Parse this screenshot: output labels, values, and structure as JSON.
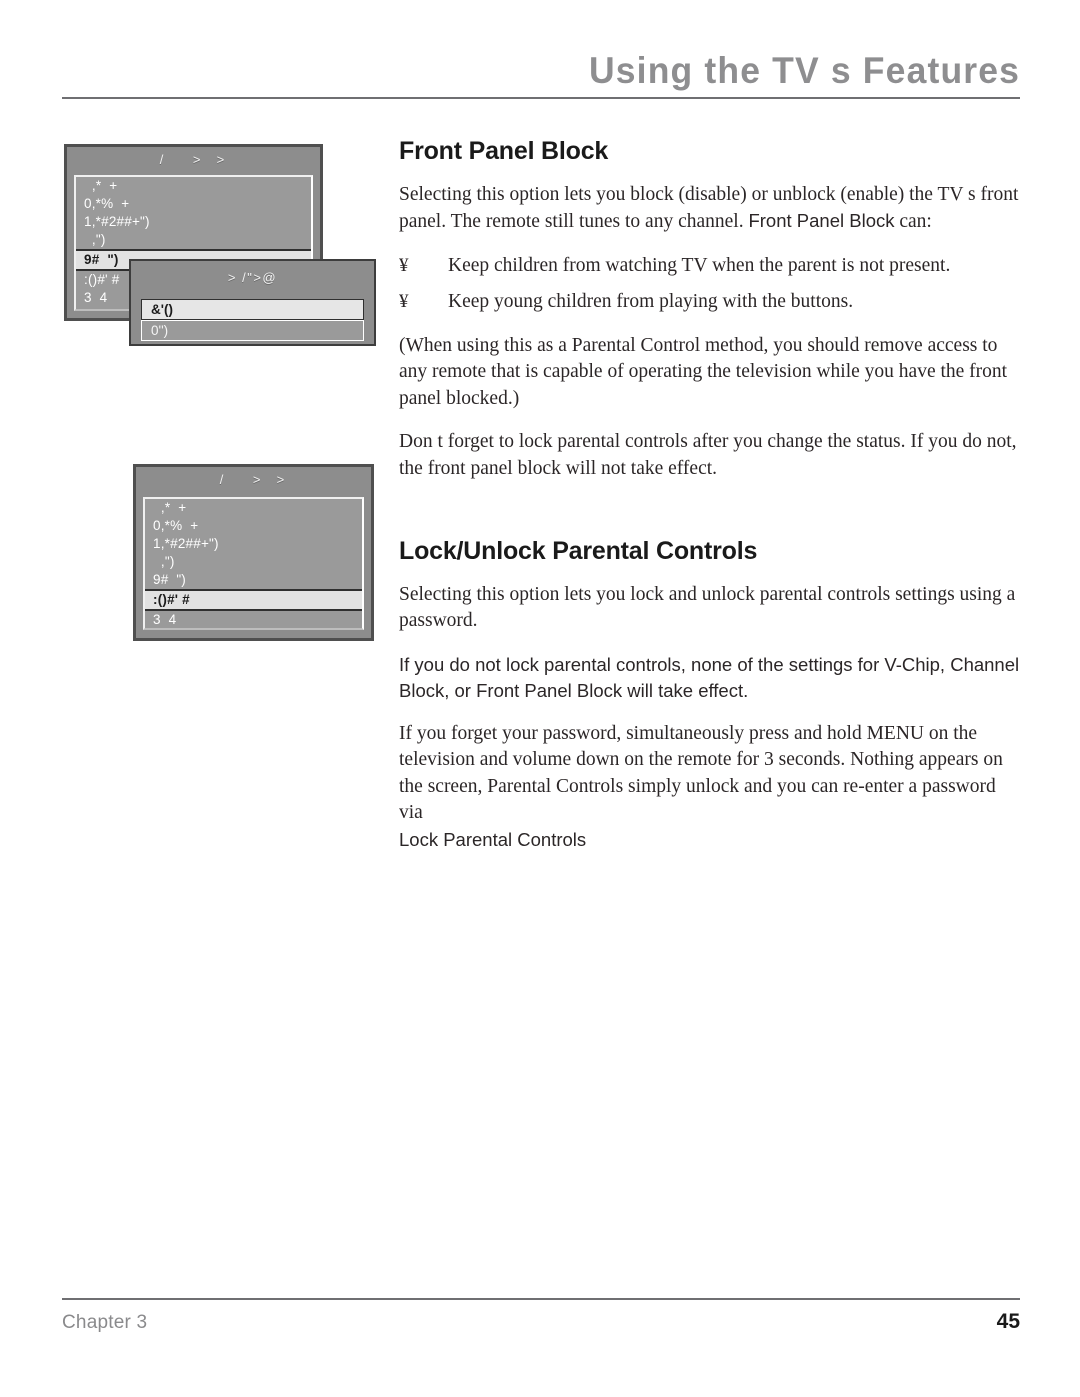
{
  "header": {
    "title": "Using the TV s Features"
  },
  "sections": {
    "front_panel_block": {
      "heading": "Front Panel Block",
      "intro_part1": "Selecting this option lets you block (disable) or unblock (enable) the TV s front panel. The remote still tunes to any channel. ",
      "intro_emphasis": "Front Panel Block",
      "intro_part2": " can:",
      "bullets": [
        {
          "mark": "¥",
          "text": "Keep children from watching TV when the parent is not present."
        },
        {
          "mark": "¥",
          "text": "Keep young children from playing with the buttons."
        }
      ],
      "note": "(When using this as a Parental Control method, you should remove access to any remote that is capable of operating the television while you have the front panel blocked.)",
      "reminder": "Don t forget to lock parental controls after you change the status. If you do not, the front panel block will not take effect."
    },
    "lock_unlock_parental_controls": {
      "heading": "Lock/Unlock Parental Controls",
      "intro": "Selecting this option lets you lock and unlock parental controls settings using a password.",
      "warning": "If you do not lock parental controls, none of the settings for V-Chip, Channel Block, or Front Panel Block will take effect.",
      "forgot_password": "If you forget your password, simultaneously press and hold MENU on the television and volume down on the remote for 3 seconds. Nothing appears on the screen, Parental Controls simply unlock and you can re-enter a password via",
      "forgot_password_tail": "Lock Parental Controls"
    }
  },
  "figures": {
    "front_panel_menu": {
      "title": "/    >  >",
      "rows": [
        {
          "label": "  ,*  +",
          "selected": false
        },
        {
          "label": "0,*%  +",
          "selected": false
        },
        {
          "label": "1,*#2##+\")",
          "selected": false
        },
        {
          "label": "  ,\")",
          "selected": false
        },
        {
          "label": "9#  \")",
          "selected": true
        },
        {
          "label": ":()#' #",
          "selected": false
        },
        {
          "label": "3  4",
          "selected": false
        }
      ]
    },
    "front_panel_popup": {
      "title": "> /\">@",
      "options": [
        {
          "label": "&'()",
          "selected": true
        },
        {
          "label": "0'')",
          "selected": false
        }
      ]
    },
    "parental_controls_menu": {
      "title": "/    >  >",
      "rows": [
        {
          "label": "  ,*  +",
          "selected": false
        },
        {
          "label": "0,*%  +",
          "selected": false
        },
        {
          "label": "1,*#2##+\")",
          "selected": false
        },
        {
          "label": "  ,\")",
          "selected": false
        },
        {
          "label": "9#  \")",
          "selected": false
        },
        {
          "label": ":()#' #",
          "selected": true
        },
        {
          "label": "3  4",
          "selected": false
        }
      ]
    }
  },
  "footer": {
    "chapter": "Chapter 3",
    "page_number": "45"
  }
}
